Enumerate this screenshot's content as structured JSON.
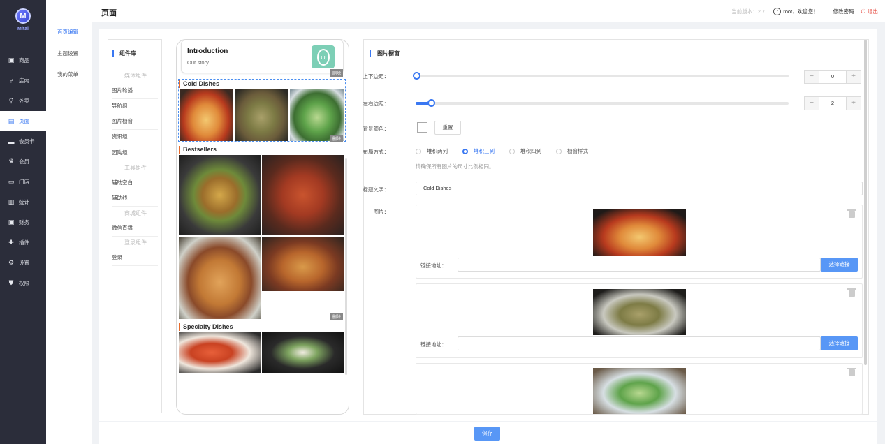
{
  "app": {
    "logo_letter": "M",
    "logo_text": "Mitai"
  },
  "sidebar": {
    "items": [
      {
        "icon": "box-icon",
        "glyph": "▣",
        "label": "商品"
      },
      {
        "icon": "fork-knife-icon",
        "glyph": "⑂",
        "label": "店内"
      },
      {
        "icon": "delivery-icon",
        "glyph": "⚲",
        "label": "外卖"
      },
      {
        "icon": "page-icon",
        "glyph": "▤",
        "label": "页面",
        "active": true
      },
      {
        "icon": "card-icon",
        "glyph": "▬",
        "label": "会员卡"
      },
      {
        "icon": "crown-icon",
        "glyph": "♛",
        "label": "会员"
      },
      {
        "icon": "store-icon",
        "glyph": "▭",
        "label": "门店"
      },
      {
        "icon": "stats-icon",
        "glyph": "▥",
        "label": "统计"
      },
      {
        "icon": "finance-icon",
        "glyph": "▣",
        "label": "财务"
      },
      {
        "icon": "puzzle-icon",
        "glyph": "✚",
        "label": "插件"
      },
      {
        "icon": "gear-icon",
        "glyph": "⚙",
        "label": "设置"
      },
      {
        "icon": "shield-icon",
        "glyph": "⛊",
        "label": "权限"
      }
    ]
  },
  "subnav": {
    "items": [
      "首页编辑",
      "主题设置",
      "我的菜单"
    ]
  },
  "header": {
    "title": "页面",
    "version": "当前版本：2.7",
    "user_greeting": "root，欢迎您！",
    "change_password": "修改密码",
    "logout": "退出"
  },
  "library": {
    "title": "组件库",
    "groups": [
      {
        "name": "媒体组件",
        "items": [
          "图片轮播",
          "导航组",
          "图片橱窗",
          "资讯组",
          "团购组"
        ]
      },
      {
        "name": "工具组件",
        "items": [
          "辅助空白",
          "辅助线"
        ]
      },
      {
        "name": "商城组件",
        "items": [
          "微信直播"
        ]
      },
      {
        "name": "登录组件",
        "items": [
          "登录"
        ]
      }
    ]
  },
  "preview": {
    "intro_title": "Introduction",
    "intro_sub": "Our story",
    "delete_label": "删除",
    "sections": [
      "Cold Dishes",
      "Bestsellers",
      "Specialty Dishes"
    ]
  },
  "editor": {
    "title": "图片橱窗",
    "vertical_margin_label": "上下边距：",
    "vertical_margin_value": "0",
    "vertical_margin_fraction": 0,
    "horizontal_margin_label": "左右边距：",
    "horizontal_margin_value": "2",
    "horizontal_margin_fraction": 0.04,
    "bg_color_label": "背景颜色：",
    "reset_label": "重置",
    "layout_label": "布局方式：",
    "layout_options": [
      "堆积两列",
      "堆积三列",
      "堆积四列",
      "橱窗样式"
    ],
    "layout_selected": 1,
    "hint": "请确保所有图片的尺寸比例相同。",
    "title_text_label": "标题文字：",
    "title_text_value": "Cold Dishes",
    "images_label": "图片：",
    "link_label": "链接地址：",
    "link_button": "选择链接",
    "minus": "−",
    "plus": "+"
  },
  "footer": {
    "save": "保存"
  }
}
